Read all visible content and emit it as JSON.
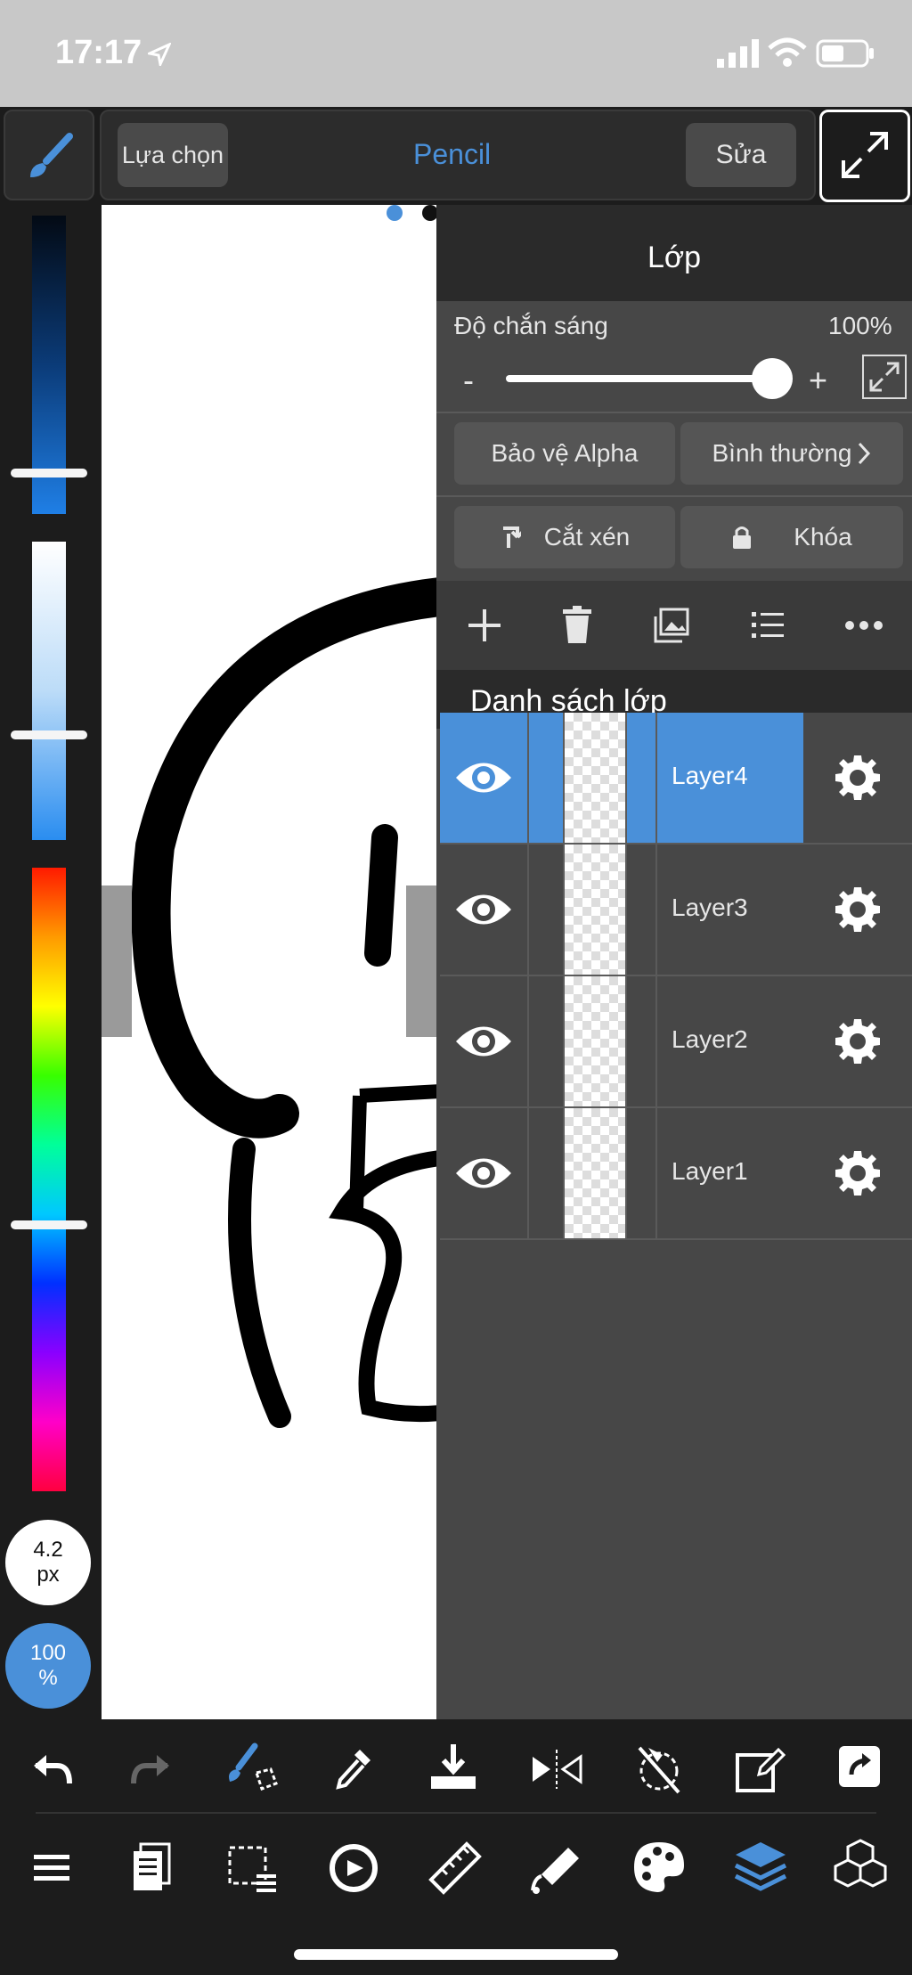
{
  "status": {
    "time": "17:17"
  },
  "topbar": {
    "select_label": "Lựa chọn",
    "tool_name": "Pencil",
    "edit_label": "Sửa"
  },
  "brush": {
    "size": "4.2",
    "size_unit": "px",
    "opacity": "100",
    "opacity_unit": "%"
  },
  "panel": {
    "title": "Lớp",
    "opacity_label": "Độ chắn sáng",
    "opacity_value": "100%",
    "minus": "-",
    "plus": "+",
    "alpha_protect": "Bảo vệ Alpha",
    "blend_mode": "Bình thường",
    "clipping": "Cắt xén",
    "lock": "Khóa",
    "list_title": "Danh sách lớp",
    "layers": [
      {
        "name": "Layer4",
        "selected": true
      },
      {
        "name": "Layer3",
        "selected": false
      },
      {
        "name": "Layer2",
        "selected": false
      },
      {
        "name": "Layer1",
        "selected": false
      }
    ]
  },
  "colors": {
    "accent": "#4a90d9",
    "panel_bg": "#474747",
    "toolbar_bg": "#1c1c1c"
  },
  "icons": [
    "brush-icon",
    "expand-icon",
    "undo-icon",
    "redo-icon",
    "brush-transform-icon",
    "eyedropper-icon",
    "import-icon",
    "flip-icon",
    "snap-icon",
    "edit-layer-icon",
    "share-icon",
    "menu-icon",
    "pages-icon",
    "selection-icon",
    "rotate-icon",
    "ruler-icon",
    "fill-icon",
    "palette-icon",
    "layers-icon",
    "materials-icon"
  ]
}
